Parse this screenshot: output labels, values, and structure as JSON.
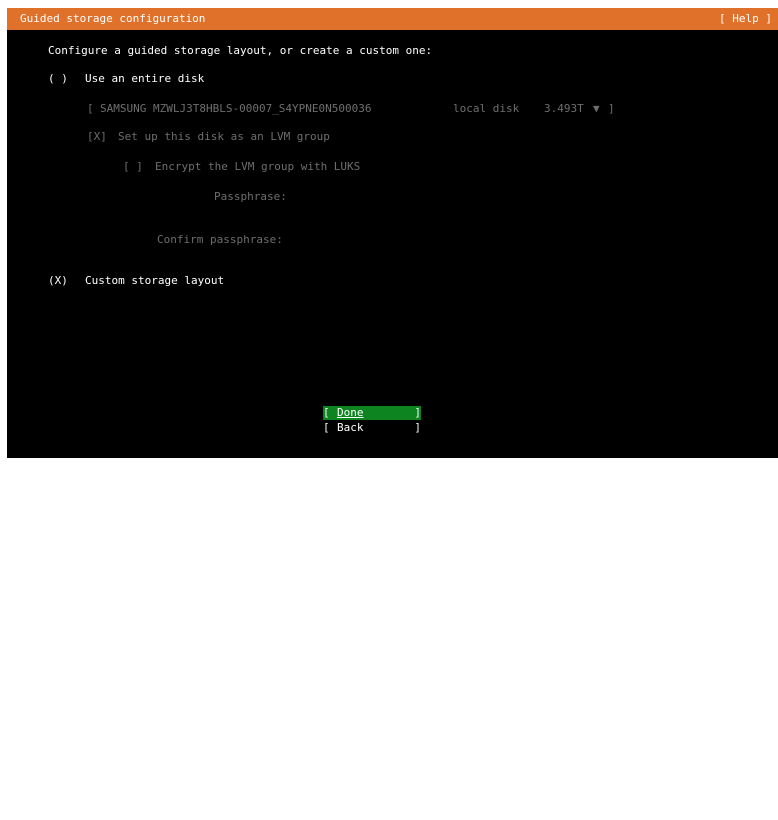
{
  "header": {
    "title": "Guided storage configuration",
    "help": "[ Help ]"
  },
  "intro": "Configure a guided storage layout, or create a custom one:",
  "options": {
    "entire_disk": {
      "radio": "( )",
      "label": "Use an entire disk"
    },
    "disk_selector": {
      "open_bracket": "[",
      "disk_name": "SAMSUNG MZWLJ3T8HBLS-00007_S4YPNE0N500036",
      "disk_type": "local disk",
      "disk_size": "3.493T",
      "arrow": "▼",
      "close_bracket": "]"
    },
    "lvm": {
      "checkbox": "[X]",
      "label": "Set up this disk as an LVM group"
    },
    "encrypt": {
      "checkbox": "[ ]",
      "label": "Encrypt the LVM group with LUKS"
    },
    "passphrase_label": "Passphrase:",
    "confirm_passphrase_label": "Confirm passphrase:",
    "custom": {
      "radio": "(X)",
      "label": "Custom storage layout"
    }
  },
  "buttons": {
    "done": {
      "open": "[",
      "label": "Done",
      "close": "]"
    },
    "back": {
      "open": "[",
      "label": "Back",
      "close": "]"
    }
  },
  "colors": {
    "header_bg": "#e0712b",
    "focus_bg": "#0e8420",
    "background": "#000000",
    "text": "#ffffff",
    "dim_text": "#6e6e6e"
  }
}
